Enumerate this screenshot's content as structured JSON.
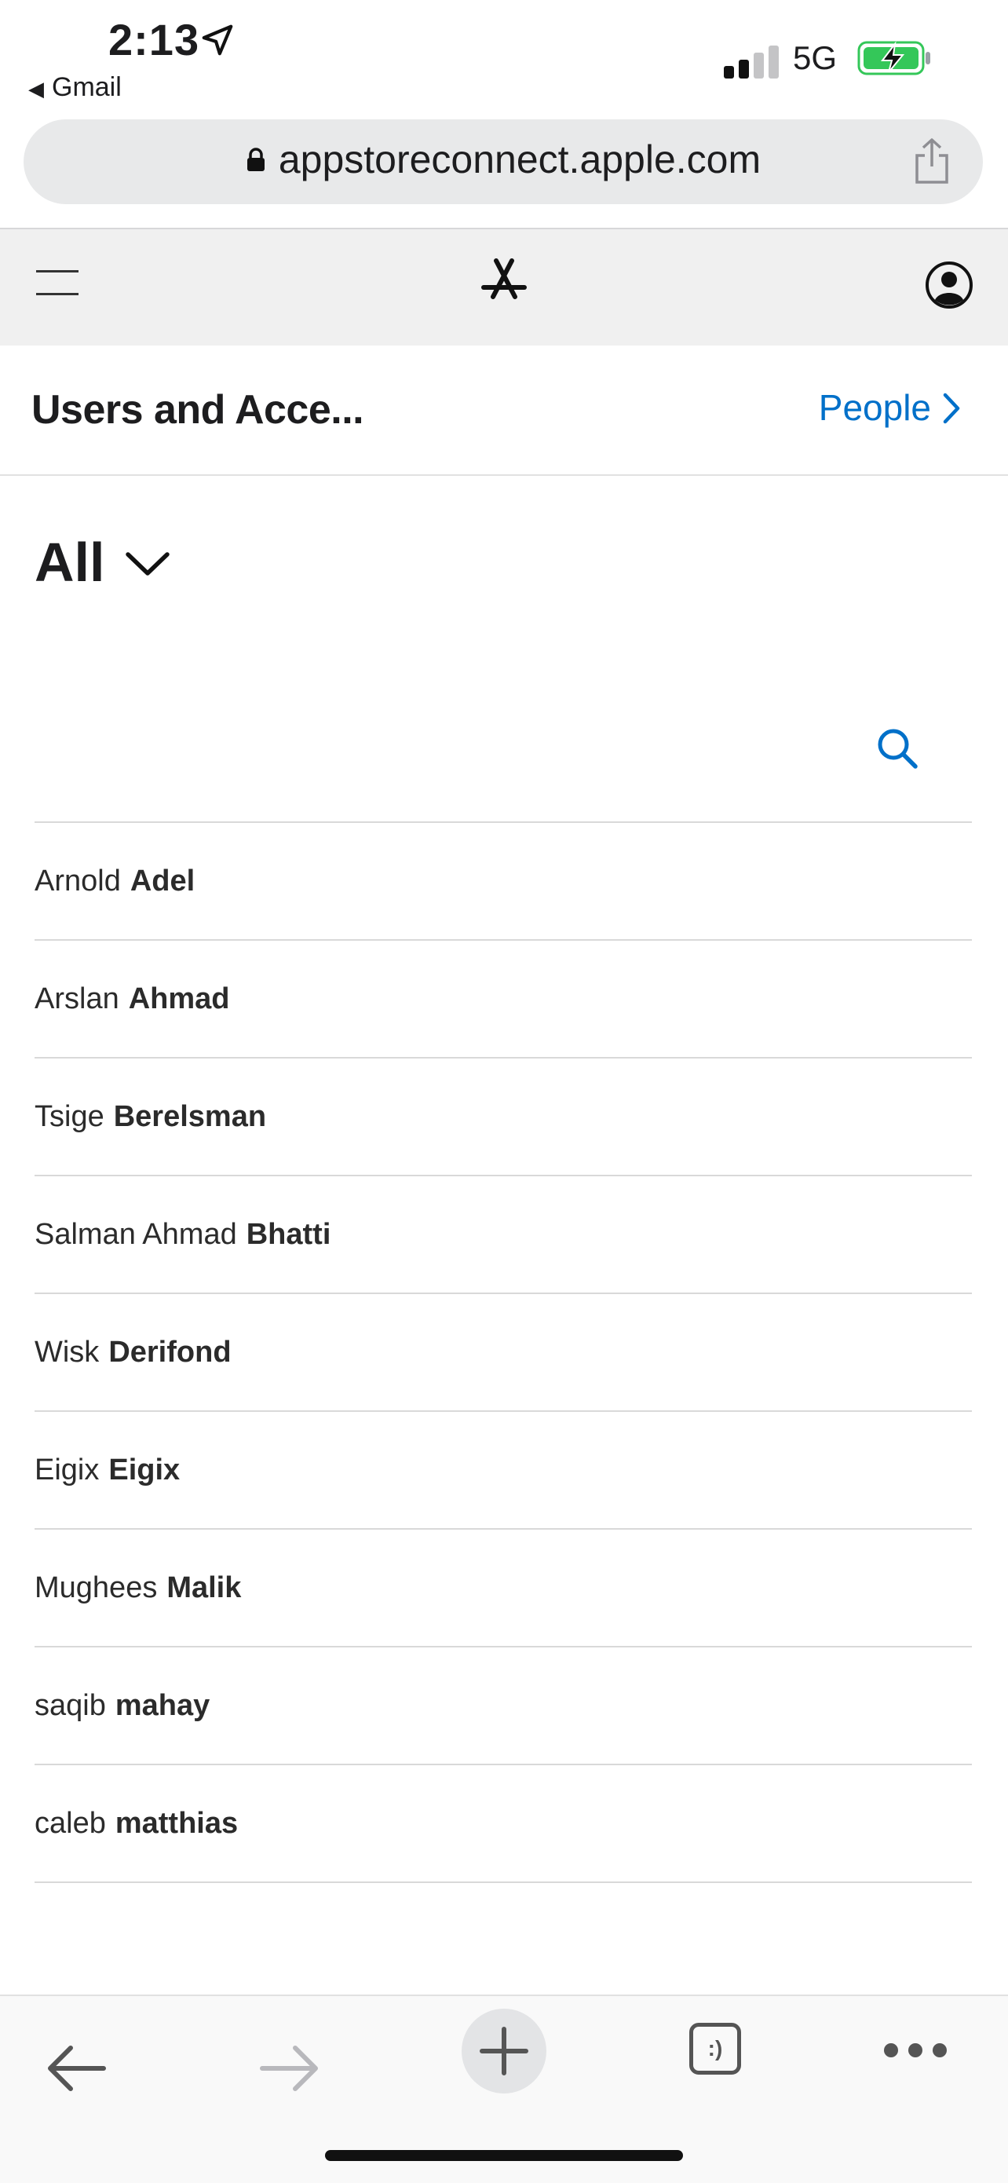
{
  "status": {
    "time": "2:13",
    "back_app": "Gmail",
    "network": "5G"
  },
  "browser": {
    "url": "appstoreconnect.apple.com"
  },
  "header": {
    "title": "Users and Acce...",
    "people_link": "People"
  },
  "filter": {
    "selected": "All"
  },
  "users": [
    {
      "first": "Arnold",
      "last": "Adel"
    },
    {
      "first": "Arslan",
      "last": "Ahmad"
    },
    {
      "first": "Tsige",
      "last": "Berelsman"
    },
    {
      "first": "Salman Ahmad",
      "last": "Bhatti"
    },
    {
      "first": "Wisk",
      "last": "Derifond"
    },
    {
      "first": "Eigix",
      "last": "Eigix"
    },
    {
      "first": "Mughees",
      "last": "Malik"
    },
    {
      "first": "saqib",
      "last": "mahay"
    },
    {
      "first": "caleb",
      "last": "matthias"
    }
  ],
  "toolbar": {
    "tabs_label": ":)"
  },
  "colors": {
    "accent": "#0070c9",
    "battery": "#34c759"
  },
  "icons": [
    "location-arrow-icon",
    "signal-icon",
    "battery-charging-icon",
    "lock-icon",
    "share-icon",
    "hamburger-menu-icon",
    "app-store-icon",
    "account-icon",
    "chevron-right-icon",
    "chevron-down-icon",
    "search-icon",
    "back-arrow-icon",
    "forward-arrow-icon",
    "plus-icon",
    "tabs-icon",
    "more-icon"
  ]
}
